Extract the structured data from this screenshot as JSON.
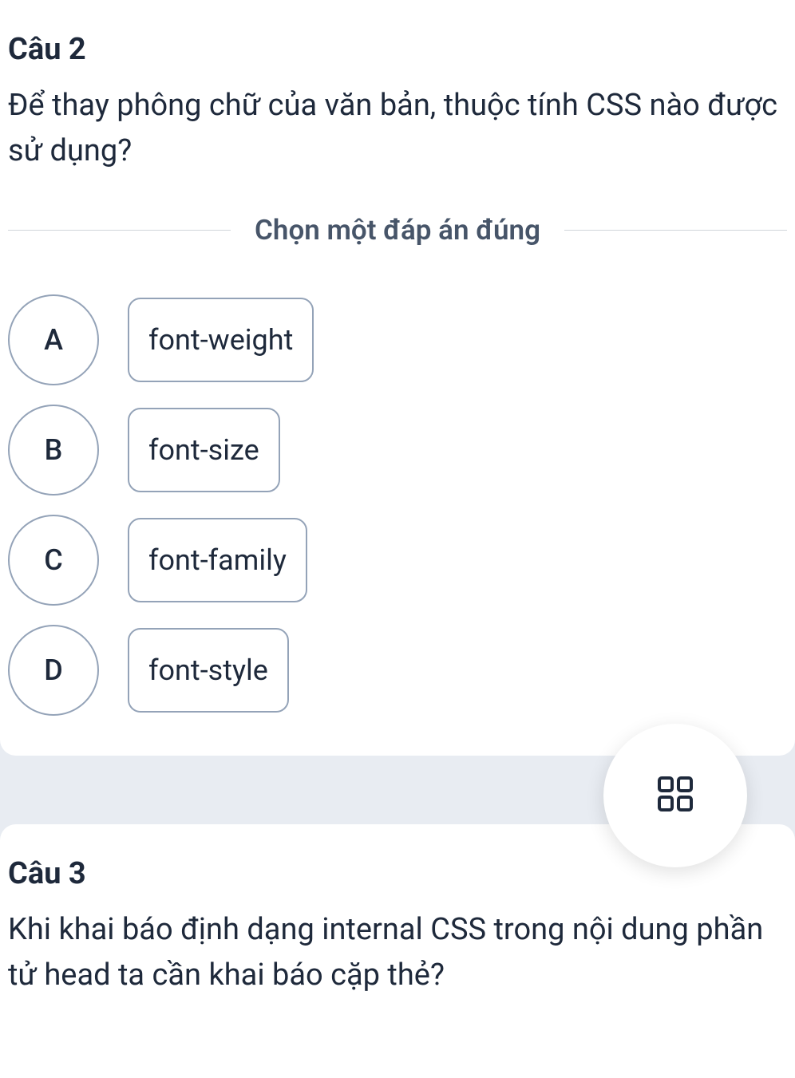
{
  "question2": {
    "title": "Câu 2",
    "text": "Để thay phông chữ của văn bản, thuộc tính CSS nào được sử dụng?",
    "instruction": "Chọn một đáp án đúng",
    "options": [
      {
        "letter": "A",
        "value": "font-weight"
      },
      {
        "letter": "B",
        "value": "font-size"
      },
      {
        "letter": "C",
        "value": "font-family"
      },
      {
        "letter": "D",
        "value": "font-style"
      }
    ]
  },
  "question3": {
    "title": "Câu 3",
    "text": "Khi khai báo định dạng internal CSS trong nội dung phần tử head ta cần khai báo cặp thẻ?"
  }
}
